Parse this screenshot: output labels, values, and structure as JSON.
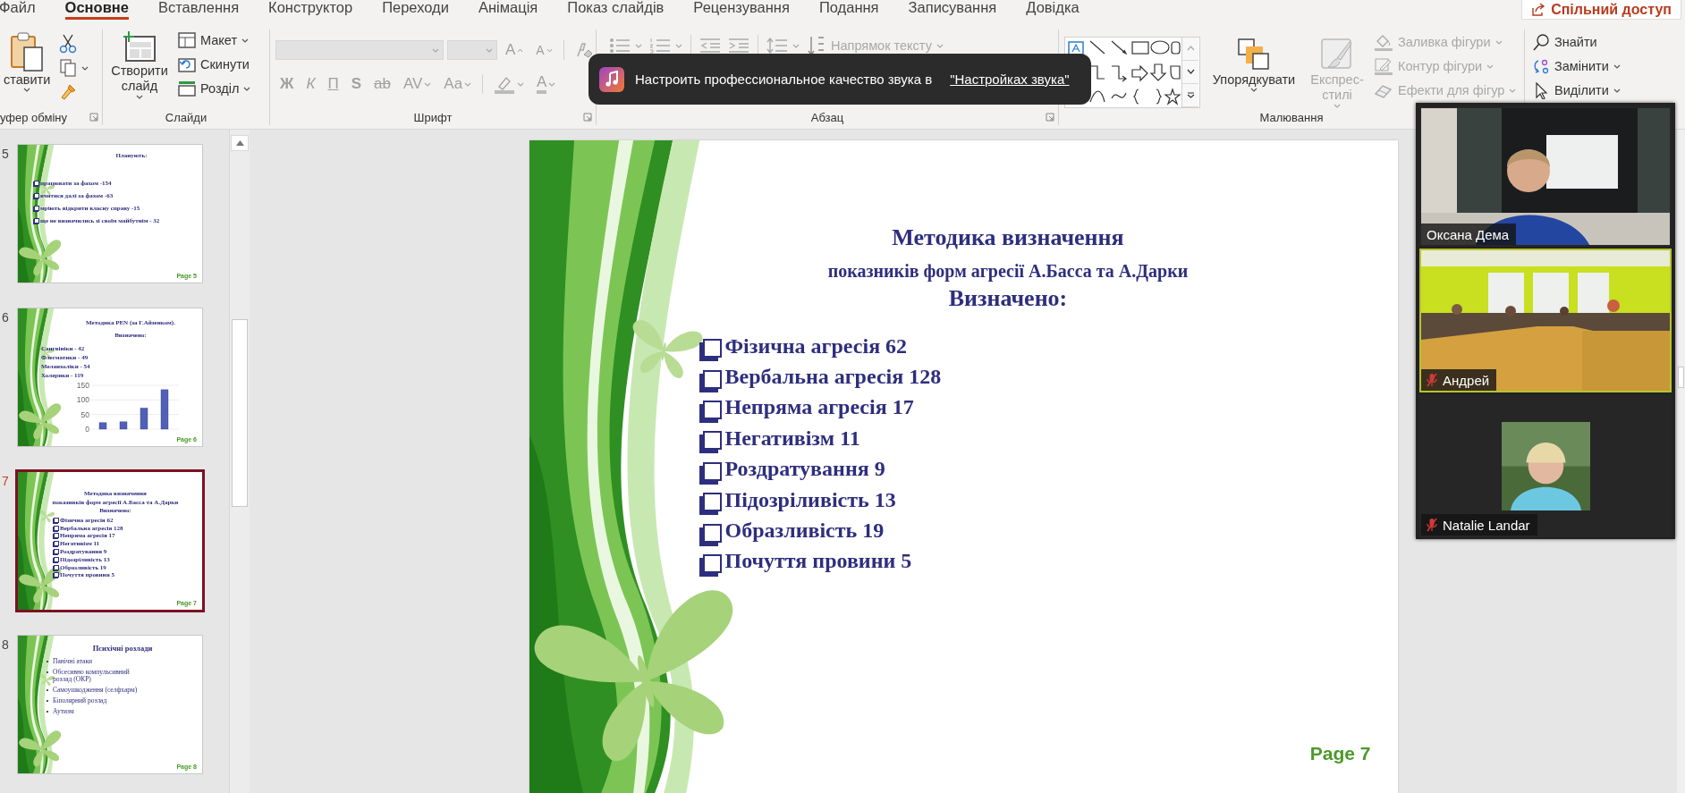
{
  "ribbon_tabs": [
    {
      "label": "Файл",
      "selected": false
    },
    {
      "label": "Основне",
      "selected": true
    },
    {
      "label": "Вставлення",
      "selected": false
    },
    {
      "label": "Конструктор",
      "selected": false
    },
    {
      "label": "Переходи",
      "selected": false
    },
    {
      "label": "Анімація",
      "selected": false
    },
    {
      "label": "Показ слайдів",
      "selected": false
    },
    {
      "label": "Рецензування",
      "selected": false
    },
    {
      "label": "Подання",
      "selected": false
    },
    {
      "label": "Записування",
      "selected": false
    },
    {
      "label": "Довідка",
      "selected": false
    }
  ],
  "share_button": {
    "label": "Спільний доступ"
  },
  "clipboard_group": {
    "paste": "ставити",
    "group_label": "уфер обміну"
  },
  "slides_group": {
    "new_slide": "Створити слайд",
    "layout": "Макет",
    "reset": "Скинути",
    "section": "Розділ",
    "group_label": "Слайди"
  },
  "font_group": {
    "disabled": true,
    "grow_font": "A",
    "shrink_font": "A",
    "format_buttons": [
      "Ж",
      "К",
      "П",
      "S",
      "ab",
      "AV",
      "Aa"
    ],
    "font_color": "A",
    "group_label": "Шрифт"
  },
  "paragraph_group": {
    "disabled": true,
    "text_direction": "Напрямок тексту",
    "group_label": "Абзац"
  },
  "drawing_group": {
    "arrange": {
      "label": "Упорядкувати",
      "disabled": false
    },
    "quick_styles": {
      "label": "Експрес-стилі",
      "disabled": true
    },
    "shape_commands": [
      {
        "label": "Заливка фігури",
        "disabled": true
      },
      {
        "label": "Контур фігури",
        "disabled": true
      },
      {
        "label": "Ефекти для фігур",
        "disabled": true
      }
    ],
    "group_label": "Малювання"
  },
  "editing_group": {
    "commands": [
      {
        "label": "Знайти"
      },
      {
        "label": "Замінити"
      },
      {
        "label": "Виділити"
      }
    ]
  },
  "thumbnails": [
    {
      "number": "5",
      "selected": false,
      "kind": "spaced-list",
      "title_lines": [
        "Планують:"
      ],
      "items": [
        "працювати за фахом  -154",
        "вчитися далі  за фахом -63",
        "мріють відкрити власну справу -15",
        "ще не визначились зі своїм майбутнім - 32"
      ],
      "page": "Page 5"
    },
    {
      "number": "6",
      "selected": false,
      "kind": "chart-list",
      "title_lines": [
        "Методика PEN (за Г.Айзенком).",
        "Визначено:"
      ],
      "items": [
        "Сангвініки   -  42",
        "Флегматики  -  49",
        "Меланхоліки  - 54",
        "Холерики     - 119"
      ],
      "page": "Page 6",
      "chart_data": {
        "type": "bar",
        "values": [
          22,
          25,
          72,
          135
        ],
        "ylim": [
          0,
          150
        ],
        "yticks": [
          0,
          50,
          100,
          150
        ]
      }
    },
    {
      "number": "7",
      "selected": true,
      "kind": "checklist",
      "title_lines": [
        "Методика визначення",
        "показників форм агресії А.Басса та А.Дарки",
        "Визначено:"
      ],
      "items": [
        "Фізична агресія 62",
        "Вербальна агресія 128",
        "Непряма агресія 17",
        "Негативізм 11",
        "Роздратування 9",
        "Підозріливість 13",
        "Образливість 19",
        "Почуття провини 5"
      ],
      "page": "Page 7"
    },
    {
      "number": "8",
      "selected": false,
      "kind": "bullet-list",
      "title_lines": [
        "Психічні розлади"
      ],
      "items": [
        "Панічні атаки",
        "Обсесивно компульсивний розлад  (ОКР)",
        "Самоушкодження (селфхарм)",
        "Біполярний розлад",
        "Аутизм"
      ],
      "page": "Page 8"
    }
  ],
  "slide": {
    "title_lines": [
      "Методика визначення",
      "показників форм агресії А.Басса та А.Дарки",
      "Визначено:"
    ],
    "items": [
      "Фізична агресія 62",
      "Вербальна агресія 128",
      "Непряма агресія 17",
      "Негативізм 11",
      "Роздратування 9",
      "Підозріливість 13",
      "Образливість 19",
      "Почуття провини 5"
    ],
    "page": "Page 7"
  },
  "notification": {
    "message": "Настроить профессиональное качество звука в",
    "link": "\"Настройках звука\""
  },
  "participants": [
    {
      "name": "Оксана Дема",
      "kind": "video",
      "muted": false,
      "active_speaker": false
    },
    {
      "name": "Андрей",
      "kind": "video",
      "muted": true,
      "active_speaker": true
    },
    {
      "name": "Natalie Landar",
      "kind": "avatar",
      "muted": true,
      "active_speaker": false
    }
  ]
}
